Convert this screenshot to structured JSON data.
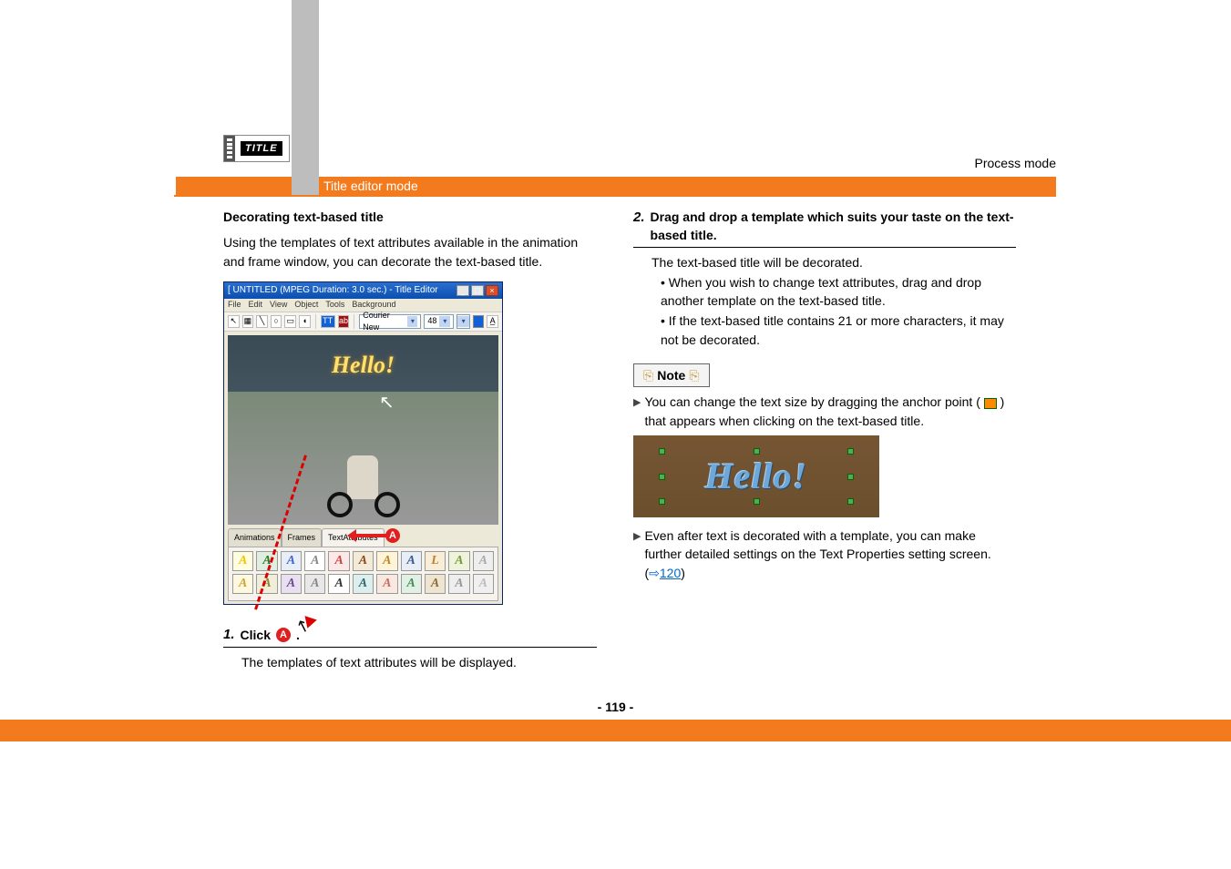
{
  "header": {
    "logo_text": "TITLE",
    "process_mode": "Process mode",
    "title_editor_mode": "Title editor mode"
  },
  "left": {
    "heading": "Decorating text-based title",
    "intro": "Using the templates of text attributes available in the animation and frame window, you can decorate the text-based title."
  },
  "screenshot1": {
    "window_title": "[ UNTITLED (MPEG Duration: 3.0 sec.) - Title Editor",
    "menu": [
      "File",
      "Edit",
      "View",
      "Object",
      "Tools",
      "Background"
    ],
    "font_name": "Courier New",
    "font_size": "48",
    "preview_text": "Hello!",
    "tabs": [
      "Animations",
      "Frames",
      "TextAttributes"
    ],
    "marker": "A"
  },
  "step1": {
    "num": "1.",
    "label_prefix": "Click ",
    "label_suffix": ".",
    "marker": "A",
    "desc": "The templates of text attributes will be displayed."
  },
  "step2": {
    "num": "2.",
    "label": "Drag and drop a template which suits your taste on the text-based title.",
    "desc": "The text-based title will be decorated.",
    "bullets": [
      "When you wish to change text attributes, drag and drop another template on the text-based title.",
      "If the text-based title contains 21 or more characters, it may not be decorated."
    ]
  },
  "note": {
    "label": "Note",
    "item1_a": "You can change the text size by dragging the anchor point ( ",
    "item1_b": " ) that appears when clicking on the text-based title.",
    "hello": "Hello!",
    "item2_a": "Even after text is decorated with a template, you can make further detailed settings on the Text Properties setting screen. (",
    "item2_link": "120",
    "item2_b": ")"
  },
  "page_number": "- 119 -"
}
